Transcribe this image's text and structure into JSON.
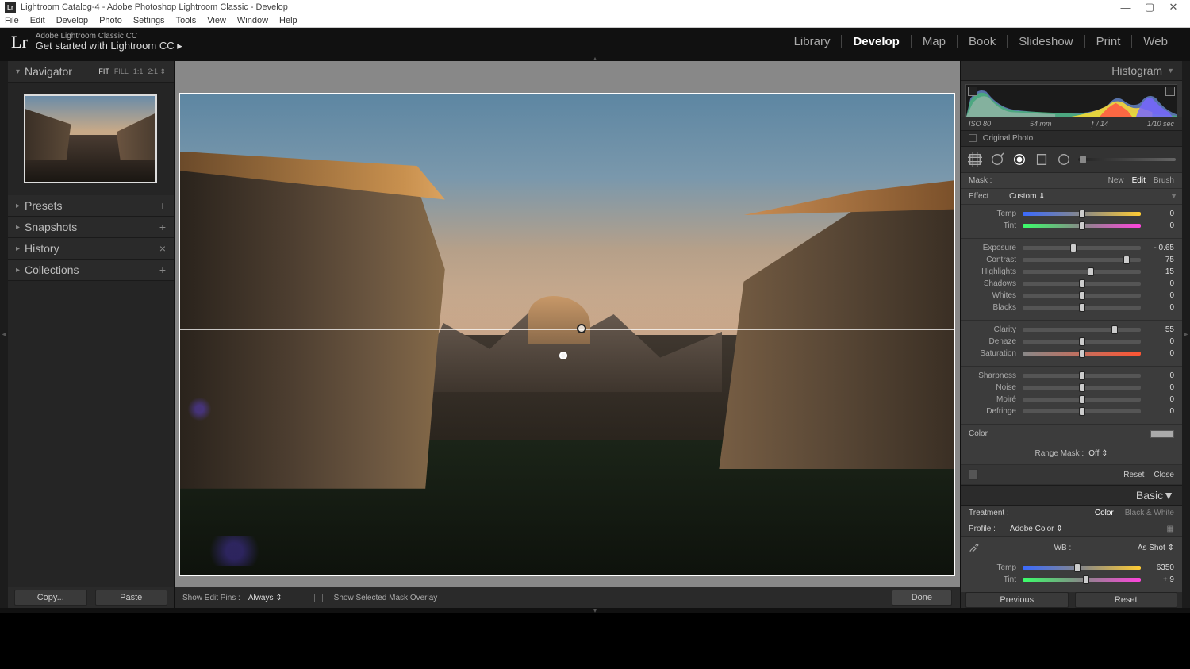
{
  "window": {
    "title": "Lightroom Catalog-4 - Adobe Photoshop Lightroom Classic - Develop",
    "controls": {
      "min": "—",
      "max": "▢",
      "close": "✕"
    }
  },
  "menubar": [
    "File",
    "Edit",
    "Develop",
    "Photo",
    "Settings",
    "Tools",
    "View",
    "Window",
    "Help"
  ],
  "header": {
    "logo": "Lr",
    "subtitle_small": "Adobe Lightroom Classic CC",
    "subtitle_big": "Get started with Lightroom CC  ▸"
  },
  "modules": {
    "items": [
      "Library",
      "Develop",
      "Map",
      "Book",
      "Slideshow",
      "Print",
      "Web"
    ],
    "active": "Develop"
  },
  "left": {
    "navigator": {
      "title": "Navigator",
      "zoom": [
        "FIT",
        "FILL",
        "1:1",
        "2:1 ⇕"
      ]
    },
    "panels": {
      "presets": {
        "label": "Presets",
        "icon": "+"
      },
      "snapshots": {
        "label": "Snapshots",
        "icon": "+"
      },
      "history": {
        "label": "History",
        "icon": "×"
      },
      "collections": {
        "label": "Collections",
        "icon": "+"
      }
    },
    "buttons": {
      "copy": "Copy...",
      "paste": "Paste"
    }
  },
  "toolbar": {
    "show_edit_pins": "Show Edit Pins :",
    "pins_value": "Always  ⇕",
    "show_mask": "Show Selected Mask Overlay",
    "done": "Done"
  },
  "right": {
    "histogram_title": "Histogram",
    "exif": {
      "iso": "ISO 80",
      "focal": "54 mm",
      "aperture": "ƒ / 14",
      "shutter": "1/10 sec"
    },
    "original": "Original Photo",
    "mask": {
      "label": "Mask :",
      "new": "New",
      "edit": "Edit",
      "brush": "Brush"
    },
    "effect": {
      "label": "Effect :",
      "value": "Custom ⇕"
    },
    "sliders_tone": [
      {
        "label": "Temp",
        "value": "0",
        "pos": 50,
        "track": "temp"
      },
      {
        "label": "Tint",
        "value": "0",
        "pos": 50,
        "track": "tint"
      }
    ],
    "sliders_exposure": [
      {
        "label": "Exposure",
        "value": "- 0.65",
        "pos": 43
      },
      {
        "label": "Contrast",
        "value": "75",
        "pos": 88
      },
      {
        "label": "Highlights",
        "value": "15",
        "pos": 58
      },
      {
        "label": "Shadows",
        "value": "0",
        "pos": 50
      },
      {
        "label": "Whites",
        "value": "0",
        "pos": 50
      },
      {
        "label": "Blacks",
        "value": "0",
        "pos": 50
      }
    ],
    "sliders_presence": [
      {
        "label": "Clarity",
        "value": "55",
        "pos": 78
      },
      {
        "label": "Dehaze",
        "value": "0",
        "pos": 50
      },
      {
        "label": "Saturation",
        "value": "0",
        "pos": 50,
        "track": "sat"
      }
    ],
    "sliders_detail": [
      {
        "label": "Sharpness",
        "value": "0",
        "pos": 50
      },
      {
        "label": "Noise",
        "value": "0",
        "pos": 50
      },
      {
        "label": "Moiré",
        "value": "0",
        "pos": 50
      },
      {
        "label": "Defringe",
        "value": "0",
        "pos": 50
      }
    ],
    "color_label": "Color",
    "range_mask": {
      "label": "Range Mask :",
      "value": "Off ⇕"
    },
    "reset_row": {
      "reset": "Reset",
      "close": "Close"
    },
    "basic": {
      "title": "Basic",
      "treatment_label": "Treatment :",
      "treatment_color": "Color",
      "treatment_bw": "Black & White",
      "profile_label": "Profile :",
      "profile_value": "Adobe Color ⇕",
      "wb_label": "WB :",
      "wb_value": "As Shot ⇕",
      "wb_sliders": [
        {
          "label": "Temp",
          "value": "6350",
          "pos": 46,
          "track": "temp"
        },
        {
          "label": "Tint",
          "value": "+ 9",
          "pos": 54,
          "track": "tint"
        }
      ]
    },
    "bottom": {
      "previous": "Previous",
      "reset": "Reset"
    }
  }
}
